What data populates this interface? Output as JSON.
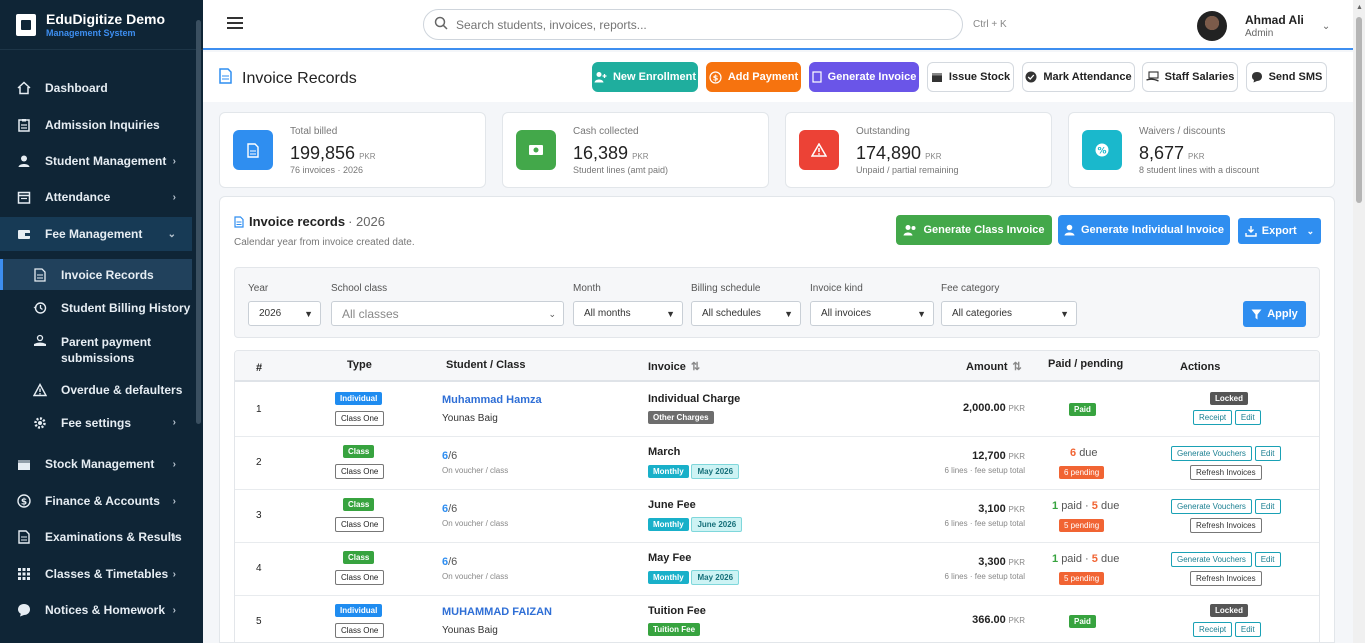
{
  "brand": {
    "name": "EduDigitize Demo",
    "tagline": "Management System"
  },
  "nav": [
    {
      "label": "Dashboard",
      "icon": "home-icon",
      "chevron": ""
    },
    {
      "label": "Admission Inquiries",
      "icon": "clipboard-icon",
      "chevron": ""
    },
    {
      "label": "Student Management",
      "icon": "student-icon",
      "chevron": "›"
    },
    {
      "label": "Attendance",
      "icon": "calendar-icon",
      "chevron": "›"
    },
    {
      "label": "Fee Management",
      "icon": "wallet-icon",
      "chevron": "⌄"
    }
  ],
  "fee_sub": [
    {
      "label": "Invoice Records",
      "icon": "file-icon"
    },
    {
      "label": "Student Billing History",
      "icon": "history-icon"
    },
    {
      "label": "Parent payment submissions",
      "icon": "hand-coin-icon"
    },
    {
      "label": "Overdue & defaulters",
      "icon": "warning-icon"
    },
    {
      "label": "Fee settings",
      "icon": "gear-icon",
      "chevron": "›"
    }
  ],
  "nav_lower": [
    {
      "label": "Stock Management",
      "icon": "box-icon",
      "chevron": "›"
    },
    {
      "label": "Finance & Accounts",
      "icon": "dollar-icon",
      "chevron": "›"
    },
    {
      "label": "Examinations & Results",
      "icon": "document-icon",
      "chevron": "›"
    },
    {
      "label": "Classes & Timetables",
      "icon": "grid-icon",
      "chevron": "›"
    },
    {
      "label": "Notices & Homework",
      "icon": "chat-icon",
      "chevron": "›"
    }
  ],
  "topbar": {
    "search_placeholder": "Search students, invoices, reports...",
    "shortcut": "Ctrl + K",
    "user_name": "Ahmad Ali",
    "user_role": "Admin"
  },
  "page": {
    "title": "Invoice Records"
  },
  "quick_actions": [
    {
      "label": "New Enrollment"
    },
    {
      "label": "Add Payment"
    },
    {
      "label": "Generate Invoice"
    },
    {
      "label": "Issue Stock"
    },
    {
      "label": "Mark Attendance"
    },
    {
      "label": "Staff Salaries"
    },
    {
      "label": "Send SMS"
    }
  ],
  "stats": [
    {
      "label": "Total billed",
      "value": "199,856",
      "unit": "PKR",
      "sub": "76 invoices · 2026",
      "color": "#2f8ef0"
    },
    {
      "label": "Cash collected",
      "value": "16,389",
      "unit": "PKR",
      "sub": "Student lines (amt paid)",
      "color": "#43a84a"
    },
    {
      "label": "Outstanding",
      "value": "174,890",
      "unit": "PKR",
      "sub": "Unpaid / partial remaining",
      "color": "#ec4236"
    },
    {
      "label": "Waivers / discounts",
      "value": "8,677",
      "unit": "PKR",
      "sub": "8 student lines with a discount",
      "color": "#1ab8cc"
    }
  ],
  "panel": {
    "title": "Invoice records",
    "year": "· 2026",
    "desc": "Calendar year from invoice created date.",
    "btn_class": "Generate Class Invoice",
    "btn_individual": "Generate Individual Invoice",
    "btn_export": "Export"
  },
  "filters": {
    "year_label": "Year",
    "year_value": "2026",
    "class_label": "School class",
    "class_value": "All classes",
    "month_label": "Month",
    "month_value": "All months",
    "schedule_label": "Billing schedule",
    "schedule_value": "All schedules",
    "kind_label": "Invoice kind",
    "kind_value": "All invoices",
    "category_label": "Fee category",
    "category_value": "All categories",
    "apply": "Apply"
  },
  "table": {
    "headers": {
      "num": "#",
      "type": "Type",
      "student": "Student / Class",
      "invoice": "Invoice",
      "amount": "Amount",
      "paid": "Paid / pending",
      "actions": "Actions"
    },
    "rows": [
      {
        "num": "1",
        "type": "Individual",
        "class_tag": "Class One",
        "name": "Muhammad Hamza",
        "parent": "Younas Baig",
        "invoice": "Individual Charge",
        "inv_tag1": "Other Charges",
        "inv_tag2": "",
        "amount": "2,000.00",
        "unit": "PKR",
        "amount_sub": "",
        "status": "Paid",
        "actions": [
          "Locked",
          "Receipt",
          "Edit"
        ]
      },
      {
        "num": "2",
        "type": "Class",
        "class_tag": "Class One",
        "count_a": "6",
        "count_b": "/6",
        "count_sub": "On voucher / class",
        "invoice": "March",
        "inv_tag1": "Monthly",
        "inv_tag2": "May 2026",
        "amount": "12,700",
        "unit": "PKR",
        "amount_sub": "6 lines · fee setup total",
        "paid_count": "",
        "due_count": "6",
        "due_label": "due",
        "pending": "6 pending",
        "actions": [
          "Generate Vouchers",
          "Edit",
          "Refresh Invoices"
        ]
      },
      {
        "num": "3",
        "type": "Class",
        "class_tag": "Class One",
        "count_a": "6",
        "count_b": "/6",
        "count_sub": "On voucher / class",
        "invoice": "June Fee",
        "inv_tag1": "Monthly",
        "inv_tag2": "June 2026",
        "amount": "3,100",
        "unit": "PKR",
        "amount_sub": "6 lines · fee setup total",
        "paid_count": "1",
        "paid_label": "paid ·",
        "due_count": "5",
        "due_label": "due",
        "pending": "5 pending",
        "actions": [
          "Generate Vouchers",
          "Edit",
          "Refresh Invoices"
        ]
      },
      {
        "num": "4",
        "type": "Class",
        "class_tag": "Class One",
        "count_a": "6",
        "count_b": "/6",
        "count_sub": "On voucher / class",
        "invoice": "May Fee",
        "inv_tag1": "Monthly",
        "inv_tag2": "May 2026",
        "amount": "3,300",
        "unit": "PKR",
        "amount_sub": "6 lines · fee setup total",
        "paid_count": "1",
        "paid_label": "paid ·",
        "due_count": "5",
        "due_label": "due",
        "pending": "5 pending",
        "actions": [
          "Generate Vouchers",
          "Edit",
          "Refresh Invoices"
        ]
      },
      {
        "num": "5",
        "type": "Individual",
        "class_tag": "Class One",
        "name": "MUHAMMAD FAIZAN",
        "parent": "Younas Baig",
        "invoice": "Tuition Fee",
        "inv_tag1": "Tuition Fee",
        "inv_tag2": "",
        "amount": "366.00",
        "unit": "PKR",
        "amount_sub": "",
        "status": "Paid",
        "actions": [
          "Locked",
          "Receipt",
          "Edit"
        ]
      }
    ]
  }
}
